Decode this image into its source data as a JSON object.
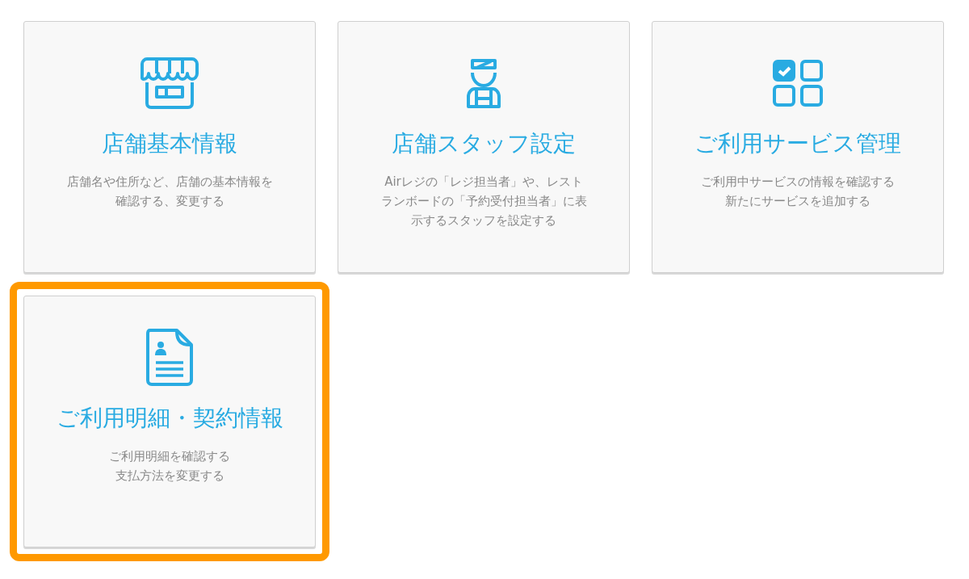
{
  "cards": [
    {
      "kind": "shop",
      "title": "店舗基本情報",
      "description": [
        "店舗名や住所など、店舗の基本情報を",
        "確認する、変更する"
      ],
      "selected": false
    },
    {
      "kind": "staff",
      "title": "店舗スタッフ設定",
      "description": [
        "Airレジの「レジ担当者」や、レスト",
        "ランボードの「予約受付担当者」に表",
        "示するスタッフを設定する"
      ],
      "selected": false
    },
    {
      "kind": "services",
      "title": "ご利用サービス管理",
      "description": [
        "ご利用中サービスの情報を確認する",
        "新たにサービスを追加する"
      ],
      "selected": false
    },
    {
      "kind": "document",
      "title": "ご利用明細・契約情報",
      "description": [
        "ご利用明細を確認する",
        "支払方法を変更する"
      ],
      "selected": true
    }
  ]
}
